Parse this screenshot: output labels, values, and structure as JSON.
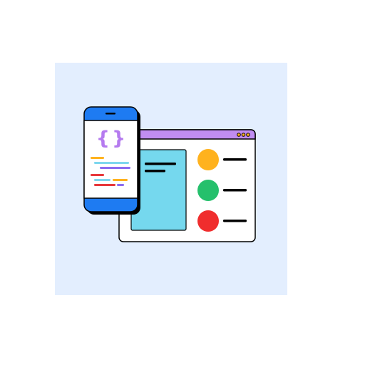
{
  "illustration": {
    "background_panel": {
      "color": "#E3EEFE"
    },
    "phone": {
      "body_color": "#1E7BF2",
      "screen_color": "#FFFFFF",
      "outline_color": "#000000",
      "braces_icon": {
        "name": "curly-braces-icon",
        "color": "#B57BEF"
      },
      "code_line_colors": [
        "#FFB21E",
        "#7ED7EE",
        "#8C6CF0",
        "#E8383B",
        "#7ED7EE",
        "#FFB21E",
        "#E8383B",
        "#8C6CF0"
      ]
    },
    "browser_window": {
      "title_bar_color": "#C08DF2",
      "window_dots_color": "#FFB21E",
      "side_panel_color": "#75D8EE",
      "list_items": [
        {
          "status_color": "#FFB21E"
        },
        {
          "status_color": "#25C06C"
        },
        {
          "status_color": "#F02D2D"
        }
      ]
    }
  }
}
